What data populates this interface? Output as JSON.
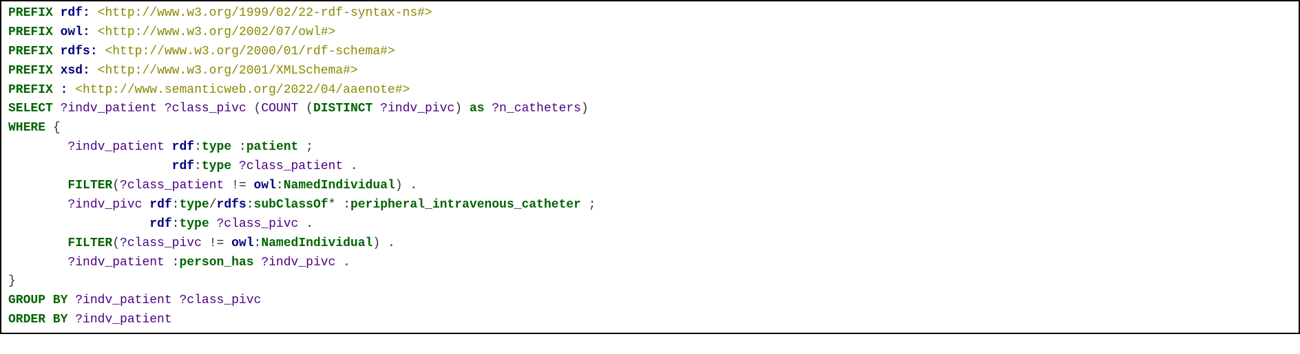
{
  "lines": [
    [
      {
        "cls": "kw-green",
        "t": "PREFIX"
      },
      {
        "cls": "plain",
        "t": " "
      },
      {
        "cls": "kw-navy",
        "t": "rdf:"
      },
      {
        "cls": "plain",
        "t": " "
      },
      {
        "cls": "uri",
        "t": "<http://www.w3.org/1999/02/22-rdf-syntax-ns#>"
      }
    ],
    [
      {
        "cls": "kw-green",
        "t": "PREFIX"
      },
      {
        "cls": "plain",
        "t": " "
      },
      {
        "cls": "kw-navy",
        "t": "owl:"
      },
      {
        "cls": "plain",
        "t": " "
      },
      {
        "cls": "uri",
        "t": "<http://www.w3.org/2002/07/owl#>"
      }
    ],
    [
      {
        "cls": "kw-green",
        "t": "PREFIX"
      },
      {
        "cls": "plain",
        "t": " "
      },
      {
        "cls": "kw-navy",
        "t": "rdfs:"
      },
      {
        "cls": "plain",
        "t": " "
      },
      {
        "cls": "uri",
        "t": "<http://www.w3.org/2000/01/rdf-schema#>"
      }
    ],
    [
      {
        "cls": "kw-green",
        "t": "PREFIX"
      },
      {
        "cls": "plain",
        "t": " "
      },
      {
        "cls": "kw-navy",
        "t": "xsd:"
      },
      {
        "cls": "plain",
        "t": " "
      },
      {
        "cls": "uri",
        "t": "<http://www.w3.org/2001/XMLSchema#>"
      }
    ],
    [
      {
        "cls": "kw-green",
        "t": "PREFIX"
      },
      {
        "cls": "plain",
        "t": " "
      },
      {
        "cls": "kw-navy",
        "t": ":"
      },
      {
        "cls": "plain",
        "t": " "
      },
      {
        "cls": "uri",
        "t": "<http://www.semanticweb.org/2022/04/aaenote#>"
      }
    ],
    [
      {
        "cls": "kw-green",
        "t": "SELECT"
      },
      {
        "cls": "plain",
        "t": " "
      },
      {
        "cls": "var",
        "t": "?indv_patient"
      },
      {
        "cls": "plain",
        "t": " "
      },
      {
        "cls": "var",
        "t": "?class_pivc"
      },
      {
        "cls": "plain",
        "t": " ("
      },
      {
        "cls": "var",
        "t": "COUNT"
      },
      {
        "cls": "plain",
        "t": " ("
      },
      {
        "cls": "kw-green",
        "t": "DISTINCT"
      },
      {
        "cls": "plain",
        "t": " "
      },
      {
        "cls": "var",
        "t": "?indv_pivc"
      },
      {
        "cls": "plain",
        "t": ") "
      },
      {
        "cls": "kw-green",
        "t": "as"
      },
      {
        "cls": "plain",
        "t": " "
      },
      {
        "cls": "var",
        "t": "?n_catheters"
      },
      {
        "cls": "plain",
        "t": ")"
      }
    ],
    [
      {
        "cls": "kw-green",
        "t": "WHERE"
      },
      {
        "cls": "plain",
        "t": " {"
      }
    ],
    [
      {
        "cls": "plain",
        "t": "        "
      },
      {
        "cls": "var",
        "t": "?indv_patient"
      },
      {
        "cls": "plain",
        "t": " "
      },
      {
        "cls": "kw-navy",
        "t": "rdf"
      },
      {
        "cls": "punct",
        "t": ":"
      },
      {
        "cls": "kw-green",
        "t": "type"
      },
      {
        "cls": "plain",
        "t": " "
      },
      {
        "cls": "punct",
        "t": ":"
      },
      {
        "cls": "kw-green",
        "t": "patient"
      },
      {
        "cls": "plain",
        "t": " ;"
      }
    ],
    [
      {
        "cls": "plain",
        "t": "                      "
      },
      {
        "cls": "kw-navy",
        "t": "rdf"
      },
      {
        "cls": "punct",
        "t": ":"
      },
      {
        "cls": "kw-green",
        "t": "type"
      },
      {
        "cls": "plain",
        "t": " "
      },
      {
        "cls": "var",
        "t": "?class_patient"
      },
      {
        "cls": "plain",
        "t": " ."
      }
    ],
    [
      {
        "cls": "plain",
        "t": "        "
      },
      {
        "cls": "kw-green",
        "t": "FILTER"
      },
      {
        "cls": "plain",
        "t": "("
      },
      {
        "cls": "var",
        "t": "?class_patient"
      },
      {
        "cls": "plain",
        "t": " != "
      },
      {
        "cls": "kw-navy",
        "t": "owl"
      },
      {
        "cls": "punct",
        "t": ":"
      },
      {
        "cls": "kw-green",
        "t": "NamedIndividual"
      },
      {
        "cls": "plain",
        "t": ") ."
      }
    ],
    [
      {
        "cls": "plain",
        "t": "        "
      },
      {
        "cls": "var",
        "t": "?indv_pivc"
      },
      {
        "cls": "plain",
        "t": " "
      },
      {
        "cls": "kw-navy",
        "t": "rdf"
      },
      {
        "cls": "punct",
        "t": ":"
      },
      {
        "cls": "kw-green",
        "t": "type"
      },
      {
        "cls": "plain",
        "t": "/"
      },
      {
        "cls": "kw-navy",
        "t": "rdfs"
      },
      {
        "cls": "punct",
        "t": ":"
      },
      {
        "cls": "kw-green",
        "t": "subClassOf"
      },
      {
        "cls": "plain",
        "t": "* "
      },
      {
        "cls": "punct",
        "t": ":"
      },
      {
        "cls": "kw-green",
        "t": "peripheral_intravenous_catheter"
      },
      {
        "cls": "plain",
        "t": " ;"
      }
    ],
    [
      {
        "cls": "plain",
        "t": "                   "
      },
      {
        "cls": "kw-navy",
        "t": "rdf"
      },
      {
        "cls": "punct",
        "t": ":"
      },
      {
        "cls": "kw-green",
        "t": "type"
      },
      {
        "cls": "plain",
        "t": " "
      },
      {
        "cls": "var",
        "t": "?class_pivc"
      },
      {
        "cls": "plain",
        "t": " ."
      }
    ],
    [
      {
        "cls": "plain",
        "t": "        "
      },
      {
        "cls": "kw-green",
        "t": "FILTER"
      },
      {
        "cls": "plain",
        "t": "("
      },
      {
        "cls": "var",
        "t": "?class_pivc"
      },
      {
        "cls": "plain",
        "t": " != "
      },
      {
        "cls": "kw-navy",
        "t": "owl"
      },
      {
        "cls": "punct",
        "t": ":"
      },
      {
        "cls": "kw-green",
        "t": "NamedIndividual"
      },
      {
        "cls": "plain",
        "t": ") ."
      }
    ],
    [
      {
        "cls": "plain",
        "t": "        "
      },
      {
        "cls": "var",
        "t": "?indv_patient"
      },
      {
        "cls": "plain",
        "t": " "
      },
      {
        "cls": "punct",
        "t": ":"
      },
      {
        "cls": "kw-green",
        "t": "person_has"
      },
      {
        "cls": "plain",
        "t": " "
      },
      {
        "cls": "var",
        "t": "?indv_pivc"
      },
      {
        "cls": "plain",
        "t": " ."
      }
    ],
    [
      {
        "cls": "plain",
        "t": "}"
      }
    ],
    [
      {
        "cls": "kw-green",
        "t": "GROUP BY"
      },
      {
        "cls": "plain",
        "t": " "
      },
      {
        "cls": "var",
        "t": "?indv_patient"
      },
      {
        "cls": "plain",
        "t": " "
      },
      {
        "cls": "var",
        "t": "?class_pivc"
      }
    ],
    [
      {
        "cls": "kw-green",
        "t": "ORDER BY"
      },
      {
        "cls": "plain",
        "t": " "
      },
      {
        "cls": "var",
        "t": "?indv_patient"
      }
    ]
  ]
}
